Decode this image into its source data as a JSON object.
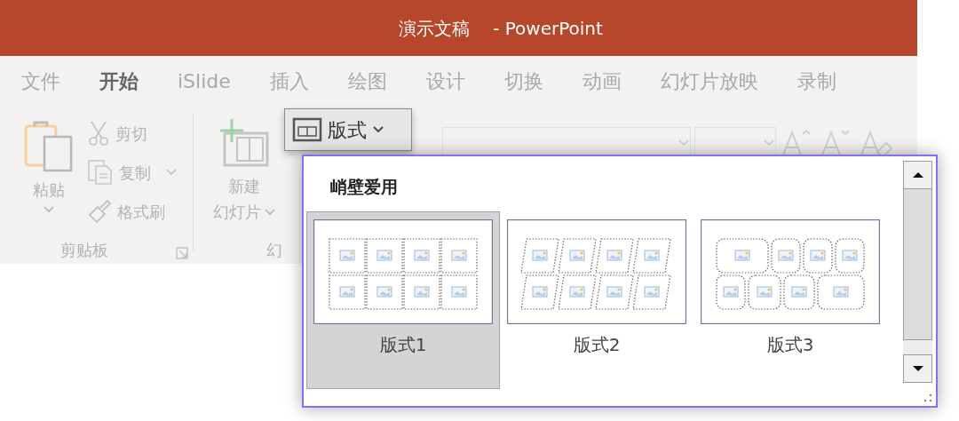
{
  "window": {
    "title": "演示文稿",
    "app_name": "- PowerPoint"
  },
  "tabs": [
    {
      "label": "文件",
      "selected": false
    },
    {
      "label": "开始",
      "selected": true
    },
    {
      "label": "iSlide",
      "selected": false
    },
    {
      "label": "插入",
      "selected": false
    },
    {
      "label": "绘图",
      "selected": false
    },
    {
      "label": "设计",
      "selected": false
    },
    {
      "label": "切换",
      "selected": false
    },
    {
      "label": "动画",
      "selected": false
    },
    {
      "label": "幻灯片放映",
      "selected": false
    },
    {
      "label": "录制",
      "selected": false
    }
  ],
  "ribbon": {
    "clipboard": {
      "paste": "粘贴",
      "cut": "剪切",
      "copy": "复制",
      "format_painter": "格式刷",
      "label": "剪贴板"
    },
    "slides": {
      "new_slide_line1": "新建",
      "new_slide_line2": "幻灯片",
      "layout_button": {
        "label": "版式",
        "open": true
      },
      "label": "幻"
    }
  },
  "layout_menu": {
    "section": "峭壁爱用",
    "layouts": [
      {
        "label": "版式1",
        "kind": "grid",
        "selected": true
      },
      {
        "label": "版式2",
        "kind": "skewed",
        "selected": false
      },
      {
        "label": "版式3",
        "kind": "rounded",
        "selected": false
      }
    ]
  }
}
